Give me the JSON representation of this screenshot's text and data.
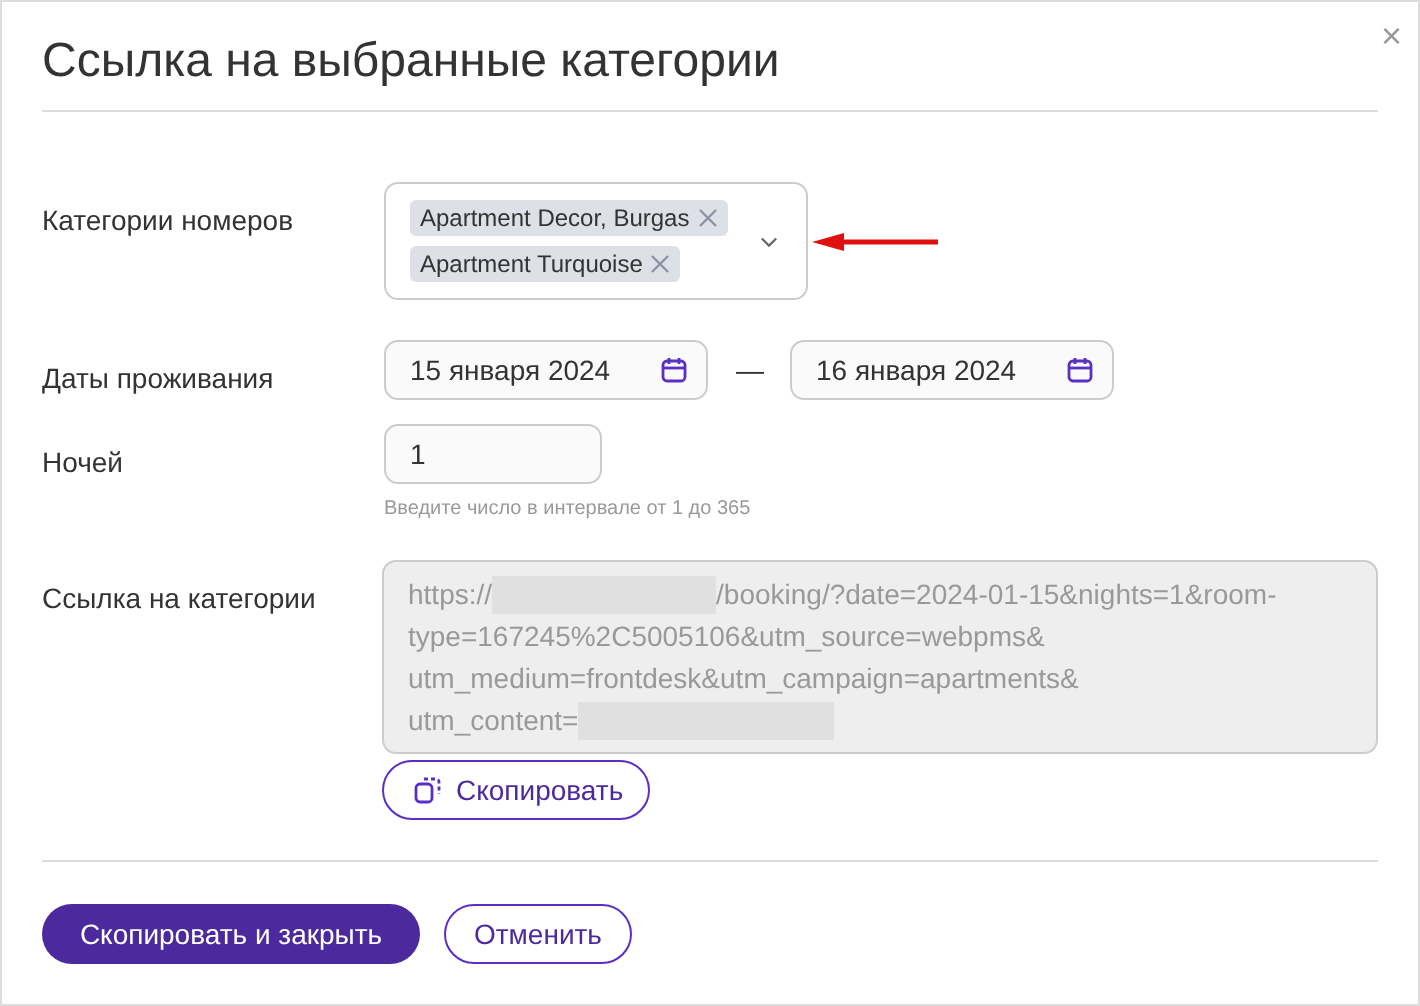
{
  "dialog": {
    "title": "Ссылка на выбранные категории",
    "close": "×"
  },
  "categories": {
    "label": "Категории номеров",
    "chips": [
      {
        "text": "Apartment Decor, Burgas"
      },
      {
        "text": "Apartment Turquoise"
      }
    ]
  },
  "dates": {
    "label": "Даты проживания",
    "from": "15 января 2024",
    "separator": "—",
    "to": "16 января 2024"
  },
  "nights": {
    "label": "Ночей",
    "value": "1",
    "hint": "Введите число в интервале от 1 до 365"
  },
  "link": {
    "label": "Ссылка на категории",
    "lines": [
      [
        {
          "kind": "text",
          "text": "https://"
        },
        {
          "kind": "redacted"
        },
        {
          "kind": "text",
          "text": "/booking/?date=2024-01-15&nights=1&room-"
        }
      ],
      [
        {
          "kind": "text",
          "text": "type=167245%2C5005106&utm_source=webpms&"
        }
      ],
      [
        {
          "kind": "text",
          "text": "utm_medium=frontdesk&utm_campaign=apartments&"
        }
      ],
      [
        {
          "kind": "text",
          "text": "utm_content="
        },
        {
          "kind": "redacted"
        }
      ]
    ],
    "copy_button": "Скопировать"
  },
  "buttons": [
    {
      "kind": "primary",
      "label": "Скопировать и закрыть"
    },
    {
      "kind": "secondary",
      "label": "Отменить"
    }
  ]
}
